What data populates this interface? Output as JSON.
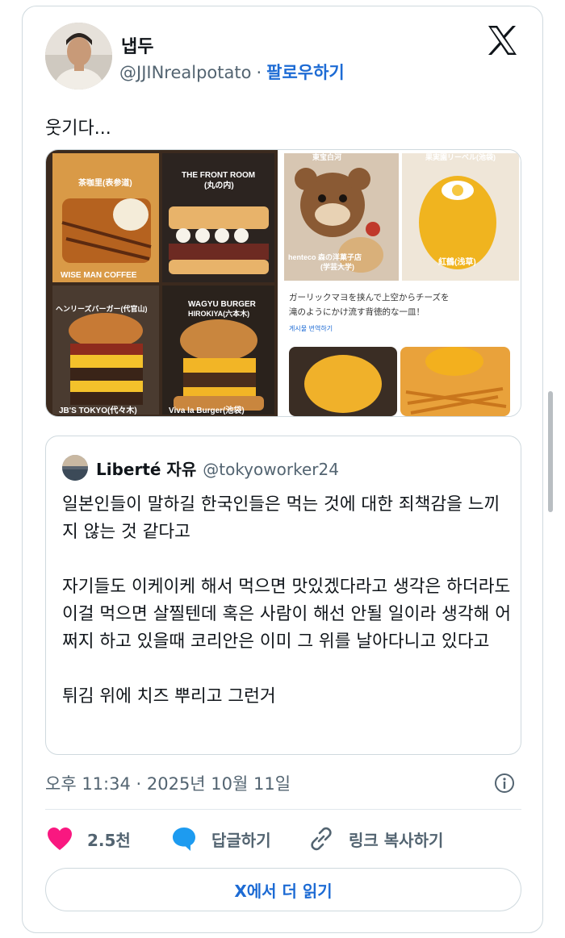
{
  "author": {
    "display_name": "냅두",
    "handle": "@JJINrealpotato",
    "separator": "·",
    "follow_label": "팔로우하기"
  },
  "tweet_text": "웃기다...",
  "media": {
    "labels": {
      "cafe1": "茶咖里(表参道)",
      "front_room": "THE FRONT ROOM",
      "front_room_sub": "(丸の内)",
      "wise_man": "WISE MAN COFFEE",
      "hennry": "ヘンリーズバーガー(代官山)",
      "wagyu": "WAGYU BURGER",
      "hirokiya": "HIROKIYA(六本木)",
      "jbs": "JB'S TOKYO(代々木)",
      "viva": "Viva la Burger(池袋)",
      "top_right_1": "東宝白河",
      "top_right_2": "果実園リーベル(池袋)",
      "henteco": "henteco 森の洋菓子店",
      "henteco_sub": "(学芸大学)",
      "kokaku": "紅鶴(浅草)"
    },
    "caption_line1": "ガーリックマヨを挟んで上空からチーズを",
    "caption_line2": "滝のようにかけ流す背徳的な一皿！",
    "translate_label": "게시물 번역하기"
  },
  "quote": {
    "display_name": "Liberté 자유",
    "handle": "@tokyoworker24",
    "para1": "일본인들이 말하길 한국인들은 먹는 것에 대한 죄책감을 느끼지 않는 것 같다고",
    "para2": "자기들도 이케이케 해서 먹으면 맛있겠다라고 생각은 하더라도 이걸 먹으면 살찔텐데 혹은 사람이 해선 안될 일이라 생각해 어쩌지 하고 있을때 코리안은 이미 그 위를 날아다니고 있다고",
    "para3": "튀김 위에 치즈 뿌리고 그런거"
  },
  "timestamp": "오후 11:34 · 2025년 10월 11일",
  "actions": {
    "like_count": "2.5천",
    "reply_label": "답글하기",
    "copy_link_label": "링크 복사하기"
  },
  "read_more_label": "X에서 더 읽기",
  "icons": {
    "x_logo": "x-logo-icon",
    "info": "info-icon",
    "like": "heart-icon",
    "reply": "speech-bubble-icon",
    "link": "link-icon"
  },
  "colors": {
    "accent": "#1d6bd4",
    "heart": "#f91880",
    "reply_bubble": "#1d9bf0",
    "secondary_text": "#536471",
    "border": "#cfd9de"
  }
}
